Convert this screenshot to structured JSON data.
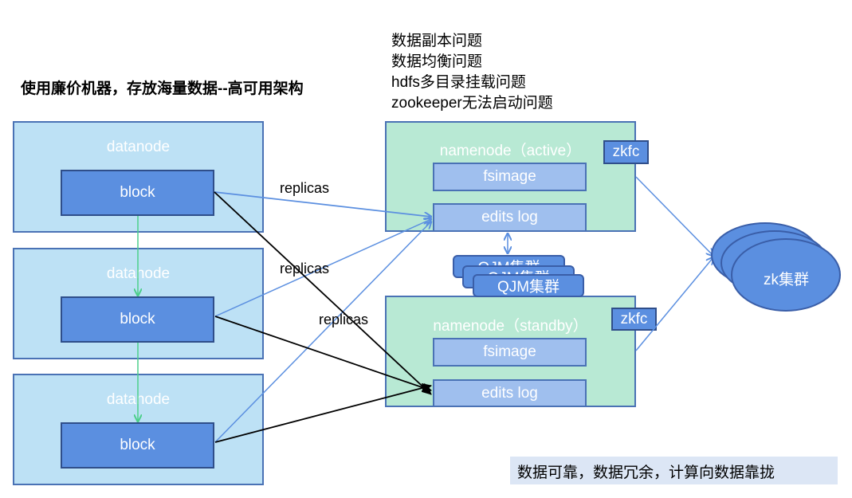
{
  "title": "使用廉价机器，存放海量数据--高可用架构",
  "issues": [
    "数据副本问题",
    "数据均衡问题",
    "hdfs多目录挂载问题",
    "zookeeper无法启动问题"
  ],
  "datanode_label": "datanode",
  "block_label": "block",
  "replicas_label": "replicas",
  "namenode_active": {
    "title": "namenode（active）",
    "fsimage": "fsimage",
    "edits": "edits log",
    "zkfc": "zkfc"
  },
  "namenode_standby": {
    "title": "namenode（standby）",
    "fsimage": "fsimage",
    "edits": "edits log",
    "zkfc": "zkfc"
  },
  "qjm_label": "QJM集群",
  "zk_label": "zk集群",
  "note": "数据可靠，数据冗余，计算向数据靠拢"
}
